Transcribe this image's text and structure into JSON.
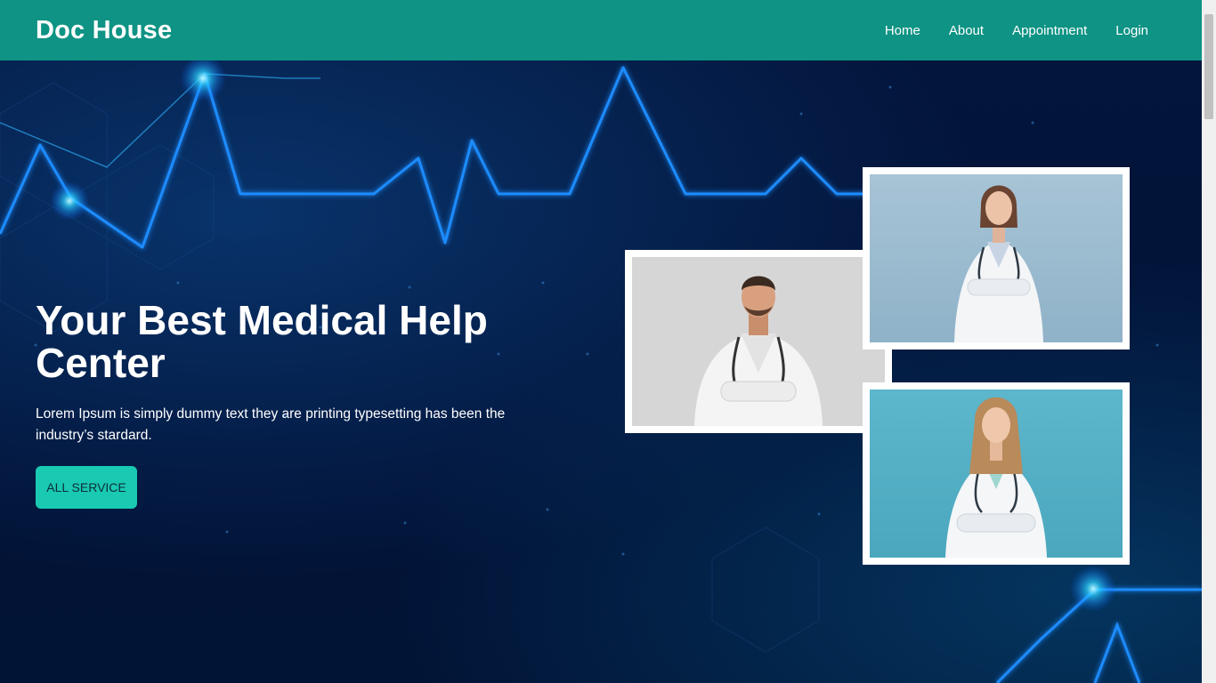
{
  "brand": "Doc House",
  "nav": {
    "items": [
      {
        "label": "Home"
      },
      {
        "label": "About"
      },
      {
        "label": "Appointment"
      },
      {
        "label": "Login"
      }
    ]
  },
  "hero": {
    "title": "Your Best Medical Help Center",
    "subtitle": "Lorem Ipsum is simply dummy text they are printing typesetting has been the industry’s stardard.",
    "button_label": "ALL SERVICE"
  },
  "colors": {
    "navbar": "#0e9384",
    "button": "#1ac9b1",
    "hero_bg": "#03153b"
  }
}
